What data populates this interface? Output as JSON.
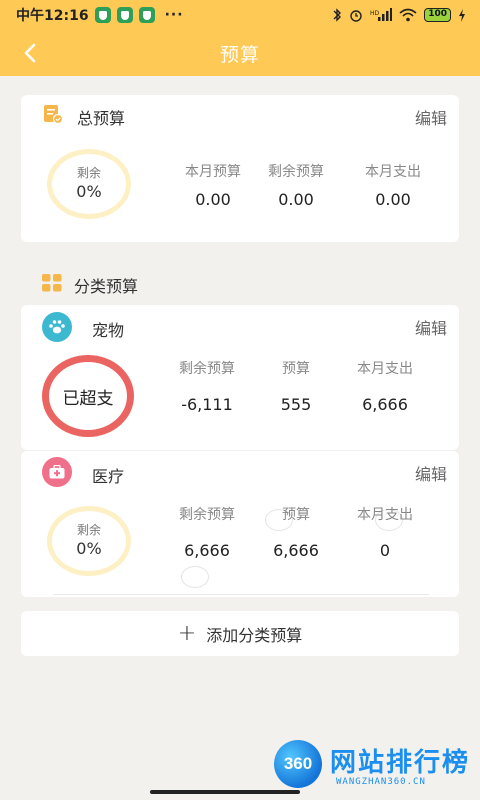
{
  "status_bar": {
    "time": "中午12:16",
    "dots": "···",
    "network": "4G",
    "battery": "100"
  },
  "nav": {
    "title": "预算"
  },
  "total_budget": {
    "title": "总预算",
    "edit_label": "编辑",
    "ring_label": "剩余",
    "ring_value": "0%",
    "stats": [
      {
        "label": "本月预算",
        "value": "0.00"
      },
      {
        "label": "剩余预算",
        "value": "0.00"
      },
      {
        "label": "本月支出",
        "value": "0.00"
      }
    ]
  },
  "category_section": {
    "title": "分类预算"
  },
  "categories": [
    {
      "name": "宠物",
      "edit_label": "编辑",
      "ring_text": "已超支",
      "icon_color": "#3cb8d1",
      "stats": [
        {
          "label": "剩余预算",
          "value": "-6,111"
        },
        {
          "label": "预算",
          "value": "555"
        },
        {
          "label": "本月支出",
          "value": "6,666"
        }
      ]
    },
    {
      "name": "医疗",
      "edit_label": "编辑",
      "ring_label": "剩余",
      "ring_value": "0%",
      "icon_color": "#f06f8a",
      "stats": [
        {
          "label": "剩余预算",
          "value": "6,666"
        },
        {
          "label": "预算",
          "value": "6,666"
        },
        {
          "label": "本月支出",
          "value": "0"
        }
      ]
    }
  ],
  "add_button": {
    "label": "添加分类预算"
  },
  "watermark": {
    "badge": "360",
    "title": "网站排行榜",
    "subtitle": "WANGZHAN360.CN"
  },
  "colors": {
    "accent": "#ffc955",
    "over_budget": "#ea6461",
    "ring_pale": "#fdf0c5"
  }
}
